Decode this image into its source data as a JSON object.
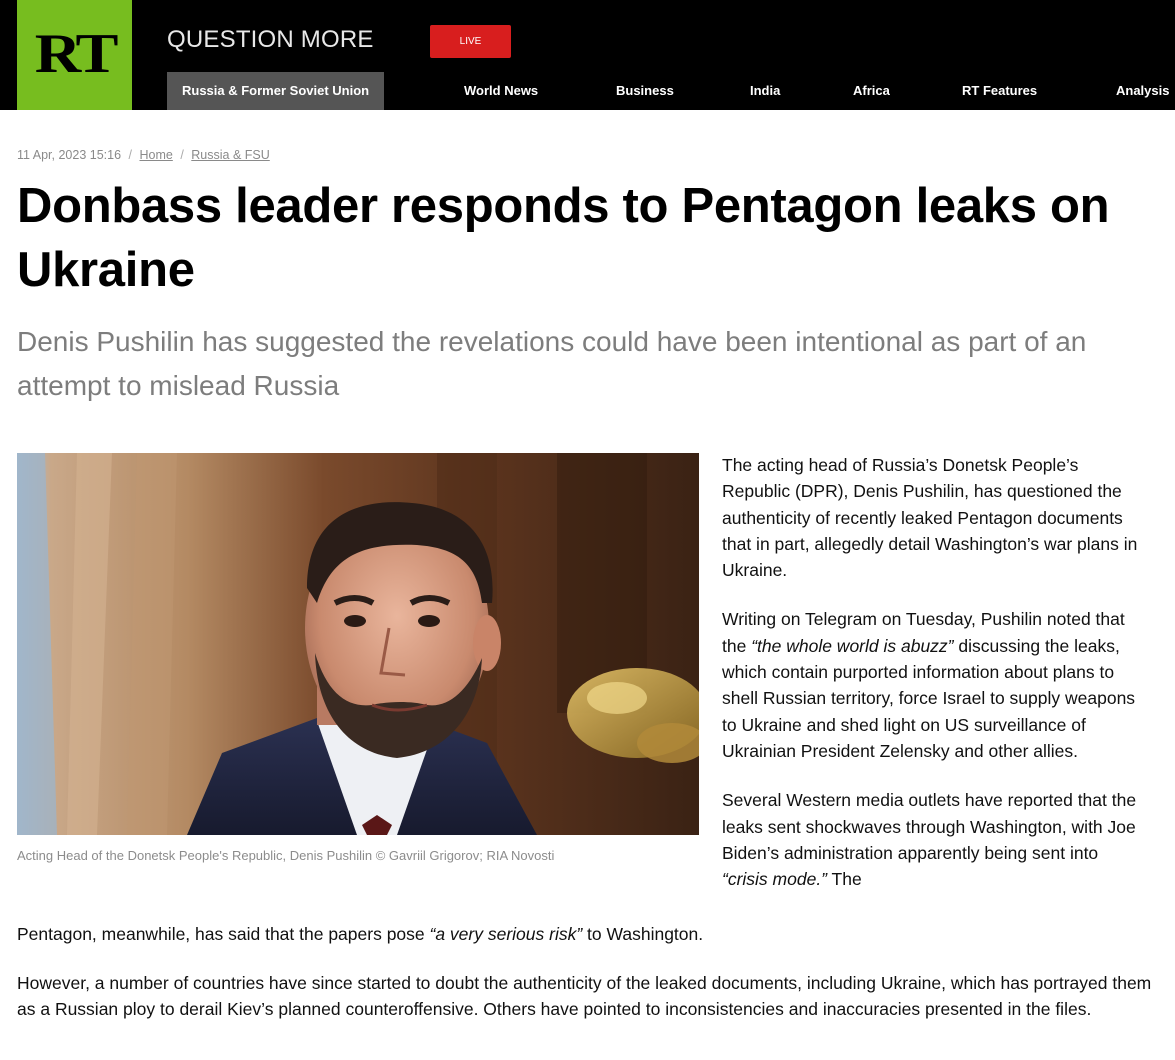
{
  "header": {
    "logo_text": "RT",
    "tagline": "QUESTION MORE",
    "live_label": "LIVE",
    "nav": [
      "Russia & Former Soviet Union",
      "World News",
      "Business",
      "India",
      "Africa",
      "RT Features",
      "Analysis"
    ],
    "colors": {
      "brand": "#77bd1f",
      "live": "#d81e1e",
      "active_nav": "#555555"
    }
  },
  "article": {
    "date": "11 Apr, 2023 15:16",
    "breadcrumb": [
      "Home",
      "Russia & FSU"
    ],
    "title": "Donbass leader responds to Pentagon leaks on Ukraine",
    "summary": "Denis Pushilin has suggested the revelations could have been intentional as part of an attempt to mislead Russia",
    "caption": "Acting Head of the Donetsk People's Republic, Denis Pushilin ©  Gavriil Grigorov;  RIA Novosti",
    "p1": "The acting head of Russia’s Donetsk People’s Republic (DPR), Denis Pushilin, has questioned the authenticity of recently leaked Pentagon documents that in part, allegedly detail Washington’s war plans in Ukraine.",
    "p2_before": "Writing on Telegram on Tuesday, Pushilin noted that the ",
    "p2_quote": "“the whole world is abuzz”",
    "p2_after": " discussing the leaks, which contain purported information about plans to shell Russian territory, force Israel to supply weapons to Ukraine and shed light on US surveillance of Ukrainian President Zelensky and other allies.",
    "p3_before": "Several Western media outlets have reported that the leaks sent shockwaves through Washington, with Joe Biden’s administration apparently being sent into ",
    "p3_quote1": "“crisis mode.”",
    "p3_mid": " The",
    "p3_cont_before": "Pentagon, meanwhile, has said that the papers pose ",
    "p3_quote2": "“a very serious risk”",
    "p3_after": " to Washington.",
    "p4": "However, a number of countries have since started to doubt the authenticity of the leaked documents, including Ukraine, which has portrayed them as a Russian ploy to derail Kiev’s planned counteroffensive. Others have pointed to inconsistencies and inaccuracies presented in the files."
  }
}
